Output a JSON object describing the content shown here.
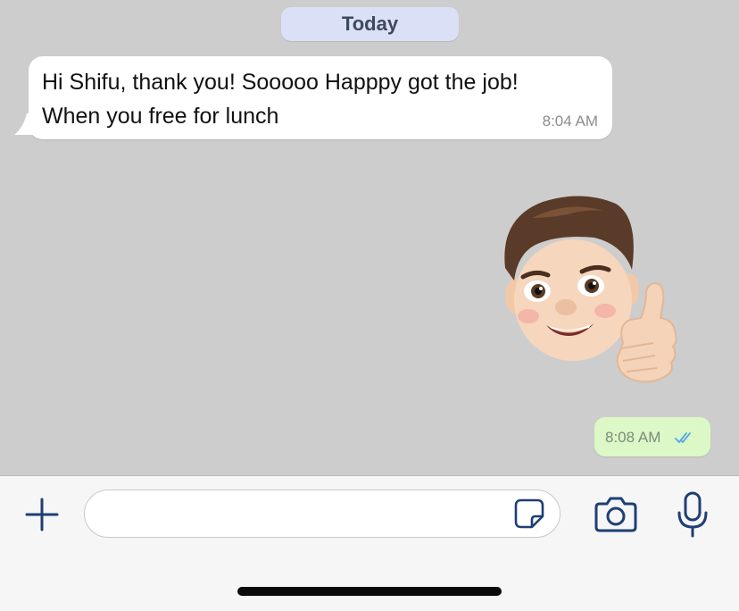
{
  "chat": {
    "date_divider": "Today",
    "messages": [
      {
        "direction": "incoming",
        "line1": "Hi Shifu, thank you! Sooooo Happpy got the job!",
        "line2": "When you free for lunch",
        "time": "8:04 AM"
      },
      {
        "direction": "outgoing",
        "type": "sticker",
        "sticker_icon": "memoji-thumbs-up",
        "time": "8:08 AM",
        "status": "read",
        "status_icon": "double-check-icon"
      }
    ]
  },
  "composer": {
    "input_value": "",
    "input_placeholder": "",
    "icons": {
      "attach": "plus-icon",
      "sticker": "sticker-icon",
      "camera": "camera-icon",
      "voice": "microphone-icon"
    }
  },
  "colors": {
    "chat_background": "#cdcdcd",
    "date_pill": "#dbe0f6",
    "incoming_bubble": "#ffffff",
    "outgoing_bubble": "#dcf8c6",
    "read_tick": "#4fa3e8",
    "icon_accent": "#1e3f75"
  }
}
